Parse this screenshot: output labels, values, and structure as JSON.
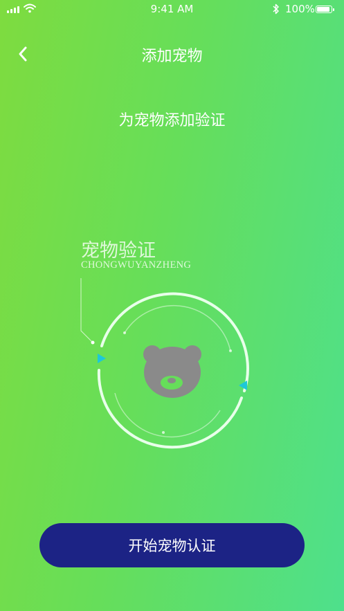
{
  "status_bar": {
    "time": "9:41 AM",
    "battery": "100%",
    "battery_level": 1.0,
    "icons": [
      "signal-icon",
      "wifi-icon",
      "bluetooth-icon",
      "battery-icon"
    ]
  },
  "nav": {
    "title": "添加宠物",
    "back_icon": "chevron-left-icon"
  },
  "subtitle": "为宠物添加验证",
  "verify": {
    "title_cn": "宠物验证",
    "title_en": "CHONGWUYANZHENG",
    "icon": "bear-face-icon"
  },
  "button": {
    "label": "开始宠物认证"
  },
  "colors": {
    "gradient_start": "#7edc3f",
    "gradient_end": "#4ee08c",
    "button": "#1c2385",
    "accent_arrow": "#1ec8d8",
    "bear": "#8a8a8a"
  }
}
